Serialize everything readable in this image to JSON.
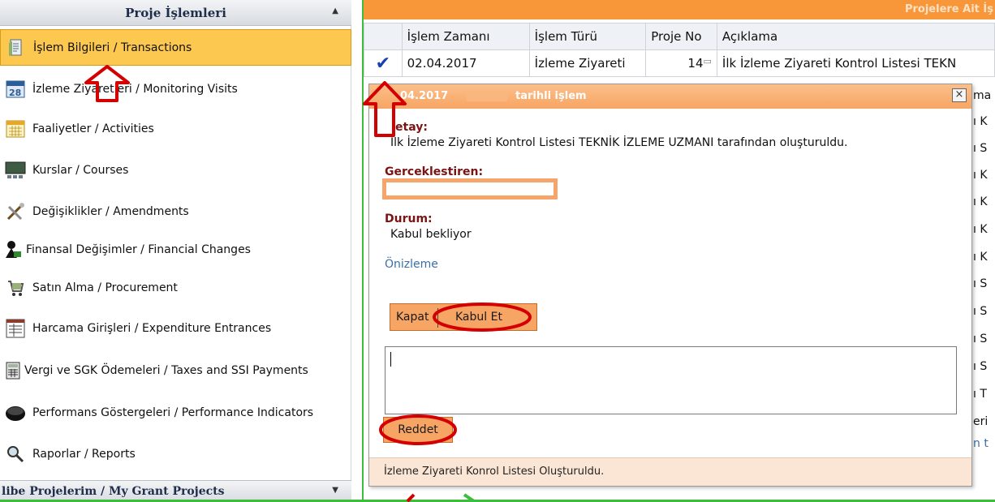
{
  "sidebar": {
    "header": "Proje İşlemleri",
    "items": [
      {
        "label": "İşlem Bilgileri / Transactions",
        "icon": "document-icon"
      },
      {
        "label": "İzleme Ziyaretleri / Monitoring Visits",
        "icon": "calendar-28-icon"
      },
      {
        "label": "Faaliyetler / Activities",
        "icon": "calendar-icon"
      },
      {
        "label": "Kurslar / Courses",
        "icon": "classroom-icon"
      },
      {
        "label": "Değişiklikler / Amendments",
        "icon": "tools-icon"
      },
      {
        "label": "Finansal Değişimler / Financial Changes",
        "icon": "money-icon"
      },
      {
        "label": "Satın Alma / Procurement",
        "icon": "cart-icon"
      },
      {
        "label": "Harcama Girişleri / Expenditure Entrances",
        "icon": "ledger-icon"
      },
      {
        "label": "Vergi ve SGK Ödemeleri / Taxes and SSI Payments",
        "icon": "calculator-icon"
      },
      {
        "label": "Performans Göstergeleri / Performance Indicators",
        "icon": "gauge-icon"
      },
      {
        "label": "Raporlar / Reports",
        "icon": "magnifier-icon"
      }
    ],
    "footer": "libe Projelerim / My Grant Projects"
  },
  "main": {
    "header": "Projelere Ait İş",
    "columns": [
      "İşlem Zamanı",
      "İşlem Türü",
      "Proje No",
      "Açıklama"
    ],
    "rows": [
      {
        "date": "02.04.2017",
        "type": "İzleme Ziyareti",
        "project_no": "14",
        "description": "İlk İzleme Ziyareti Kontrol Listesi TEKN"
      }
    ],
    "right_fragments": [
      "ma",
      "ı K",
      "ı S",
      "ı K",
      "ı K",
      "ı K",
      "ı K",
      "ı S",
      "ı S",
      "ı S",
      "ı S",
      "ı T",
      "eri",
      "n t"
    ]
  },
  "dialog": {
    "title_date": "04.2017",
    "title_text": "tarihli işlem",
    "close_label": "×",
    "detail_label": "etay:",
    "detail_text": "İlk İzleme Ziyareti Kontrol Listesi TEKNİK İZLEME UZMANI tarafından oluşturuldu.",
    "performer_label": "Gerceklestiren:",
    "status_label": "Durum:",
    "status_value": "Kabul bekliyor",
    "preview_link": "Önizleme",
    "close_button": "Kapat",
    "accept_button": "Kabul Et",
    "reject_button": "Reddet",
    "footer_text": "İzleme Ziyareti Konrol Listesi Oluşturuldu."
  },
  "colors": {
    "accent_orange": "#f7a564",
    "header_orange": "#f79739",
    "active_yellow": "#fcc84f",
    "label_red": "#7a1414",
    "annotation_red": "#d40000",
    "annotation_green": "#3cbd3c"
  }
}
